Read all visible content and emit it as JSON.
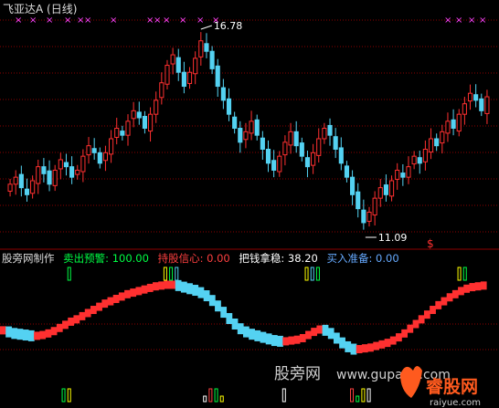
{
  "top_panel": {
    "title": "飞亚达A",
    "period": "(日线)",
    "high_label": "16.78",
    "low_label": "11.09",
    "signal_mark": "$",
    "marker_glyph": "×"
  },
  "bottom_panel": {
    "indicator_name": "股旁网制作",
    "metrics": [
      {
        "label": "卖出预警:",
        "value": "100.00"
      },
      {
        "label": "持股信心:",
        "value": "0.00"
      },
      {
        "label": "把钱拿稳:",
        "value": "38.20"
      },
      {
        "label": "买入准备:",
        "value": "0.00"
      }
    ]
  },
  "watermark": {
    "text1": "股旁网",
    "text2": "www.gupang.com",
    "logo_text": "睿股网",
    "logo_url": "raiyue.com"
  },
  "colors": {
    "up": "#ff3030",
    "down": "#54d2f2",
    "magenta": "#ff44ff",
    "grid": "#8b0000",
    "text": "#dddddd",
    "green": "#00ff44",
    "red_text": "#ff4040",
    "white": "#ffffff",
    "blue_text": "#66aaff",
    "yellow": "#ffff00"
  },
  "chart_data": {
    "type": "candlestick",
    "y_high": 16.78,
    "y_low": 11.09,
    "closes": [
      12.4,
      12.6,
      12.3,
      12.1,
      12.5,
      12.9,
      12.7,
      12.4,
      12.8,
      13.1,
      12.9,
      12.6,
      12.8,
      13.2,
      13.5,
      13.3,
      13.0,
      13.3,
      13.7,
      14.0,
      13.8,
      14.2,
      14.5,
      14.3,
      14.0,
      14.4,
      14.8,
      15.3,
      15.8,
      16.1,
      15.6,
      15.2,
      15.6,
      16.0,
      16.5,
      16.2,
      15.7,
      15.2,
      14.8,
      14.4,
      14.0,
      13.6,
      13.9,
      14.2,
      13.8,
      13.4,
      13.0,
      12.8,
      13.2,
      13.6,
      13.9,
      13.5,
      13.2,
      12.9,
      13.3,
      13.7,
      14.0,
      13.8,
      13.4,
      13.0,
      12.6,
      12.1,
      11.7,
      11.3,
      11.6,
      12.0,
      12.3,
      12.1,
      12.5,
      12.8,
      12.6,
      12.9,
      13.2,
      13.0,
      13.4,
      13.7,
      13.5,
      13.9,
      14.2,
      14.0,
      14.4,
      14.7,
      15.0,
      14.8,
      14.5,
      14.9
    ],
    "curve": [
      42,
      40,
      38,
      37,
      36,
      35,
      35,
      36,
      38,
      41,
      45,
      49,
      53,
      56,
      60,
      64,
      68,
      72,
      76,
      79,
      82,
      85,
      88,
      90,
      92,
      94,
      96,
      98,
      99,
      100,
      100,
      99,
      97,
      95,
      93,
      90,
      86,
      80,
      73,
      65,
      57,
      50,
      44,
      40,
      37,
      35,
      33,
      31,
      29,
      28,
      28,
      29,
      30,
      32,
      36,
      40,
      43,
      42,
      38,
      32,
      26,
      21,
      18,
      18,
      19,
      20,
      22,
      24,
      26,
      29,
      33,
      38,
      44,
      50,
      56,
      62,
      68,
      74,
      79,
      84,
      88,
      92,
      95,
      97,
      98,
      99
    ],
    "buy_marks": [
      12,
      29,
      30,
      31,
      54,
      55,
      56,
      81,
      82
    ],
    "bottom_bars": [
      11,
      12,
      36,
      37,
      38,
      39,
      50,
      62,
      63,
      64,
      65
    ]
  }
}
